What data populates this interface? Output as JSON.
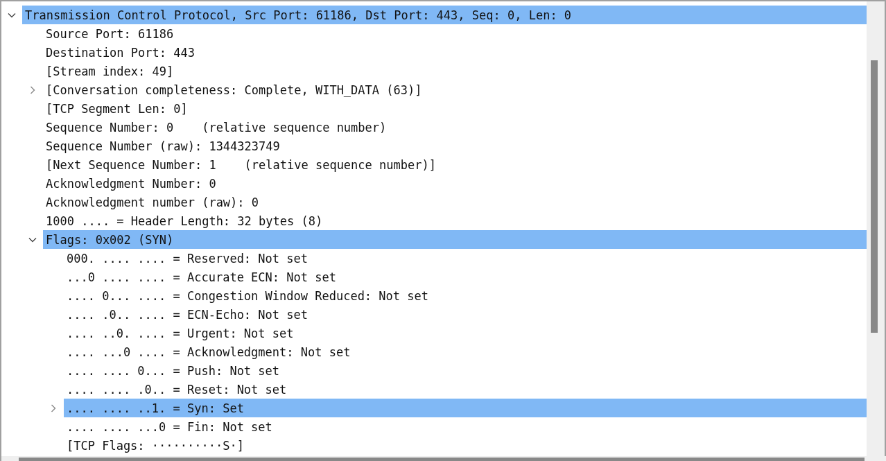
{
  "tree": [
    {
      "label": "Transmission Control Protocol, Src Port: 61186, Dst Port: 443, Seq: 0, Len: 0",
      "kind": "branch",
      "expanded": true,
      "selected": true,
      "children": [
        {
          "label": "Source Port: 61186",
          "kind": "leaf",
          "selected": false
        },
        {
          "label": "Destination Port: 443",
          "kind": "leaf",
          "selected": false
        },
        {
          "label": "[Stream index: 49]",
          "kind": "leaf",
          "selected": false
        },
        {
          "label": "[Conversation completeness: Complete, WITH_DATA (63)]",
          "kind": "branch",
          "expanded": false,
          "selected": false
        },
        {
          "label": "[TCP Segment Len: 0]",
          "kind": "leaf",
          "selected": false
        },
        {
          "label": "Sequence Number: 0    (relative sequence number)",
          "kind": "leaf",
          "selected": false
        },
        {
          "label": "Sequence Number (raw): 1344323749",
          "kind": "leaf",
          "selected": false
        },
        {
          "label": "[Next Sequence Number: 1    (relative sequence number)]",
          "kind": "leaf",
          "selected": false
        },
        {
          "label": "Acknowledgment Number: 0",
          "kind": "leaf",
          "selected": false
        },
        {
          "label": "Acknowledgment number (raw): 0",
          "kind": "leaf",
          "selected": false
        },
        {
          "label": "1000 .... = Header Length: 32 bytes (8)",
          "kind": "leaf",
          "selected": false
        },
        {
          "label": "Flags: 0x002 (SYN)",
          "kind": "branch",
          "expanded": true,
          "selected": true,
          "children": [
            {
              "label": "000. .... .... = Reserved: Not set",
              "kind": "leaf",
              "selected": false
            },
            {
              "label": "...0 .... .... = Accurate ECN: Not set",
              "kind": "leaf",
              "selected": false
            },
            {
              "label": ".... 0... .... = Congestion Window Reduced: Not set",
              "kind": "leaf",
              "selected": false
            },
            {
              "label": ".... .0.. .... = ECN-Echo: Not set",
              "kind": "leaf",
              "selected": false
            },
            {
              "label": ".... ..0. .... = Urgent: Not set",
              "kind": "leaf",
              "selected": false
            },
            {
              "label": ".... ...0 .... = Acknowledgment: Not set",
              "kind": "leaf",
              "selected": false
            },
            {
              "label": ".... .... 0... = Push: Not set",
              "kind": "leaf",
              "selected": false
            },
            {
              "label": ".... .... .0.. = Reset: Not set",
              "kind": "leaf",
              "selected": false
            },
            {
              "label": ".... .... ..1. = Syn: Set",
              "kind": "branch",
              "expanded": false,
              "selected": true
            },
            {
              "label": ".... .... ...0 = Fin: Not set",
              "kind": "leaf",
              "selected": false
            },
            {
              "label": "[TCP Flags: ··········S·]",
              "kind": "leaf",
              "selected": false
            }
          ]
        }
      ]
    }
  ]
}
